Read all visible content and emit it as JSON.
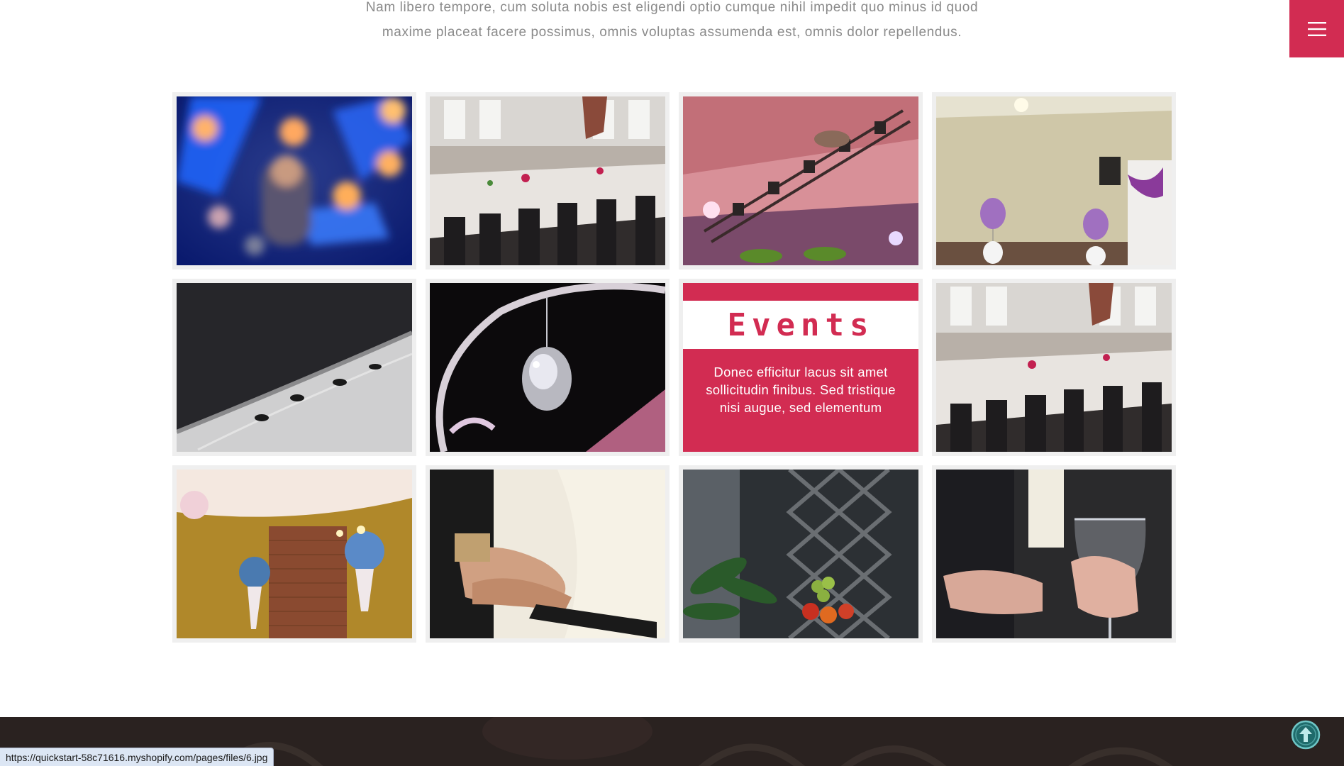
{
  "intro": {
    "line1": "Nam libero tempore, cum soluta nobis est eligendi optio cumque nihil impedit quo minus id quod",
    "line2": "maxime placeat facere possimus, omnis voluptas assumenda est, omnis dolor repellendus."
  },
  "menu": {
    "icon": "hamburger-menu-icon",
    "color": "#d22c52"
  },
  "gallery": {
    "tiles": [
      {
        "row": 1,
        "col": 1,
        "scene": "blurred blue and orange stage lights with performer"
      },
      {
        "row": 1,
        "col": 2,
        "scene": "banquet tables with white tablecloths and black chairs"
      },
      {
        "row": 1,
        "col": 3,
        "scene": "pink-lit hall ceiling with lighting truss"
      },
      {
        "row": 1,
        "col": 4,
        "scene": "hall with purple and white balloons"
      },
      {
        "row": 2,
        "col": 1,
        "scene": "close-up of white cake edge on dark background"
      },
      {
        "row": 2,
        "col": 2,
        "scene": "crystal jewelry close-up"
      },
      {
        "row": 2,
        "col": 3,
        "type": "events"
      },
      {
        "row": 2,
        "col": 4,
        "scene": "banquet tables with white tablecloths and black chairs"
      },
      {
        "row": 3,
        "col": 1,
        "scene": "hot-air-balloon decorations with brick wall"
      },
      {
        "row": 3,
        "col": 2,
        "scene": "hands cutting a cake"
      },
      {
        "row": 3,
        "col": 3,
        "scene": "fruit display near lattice screen"
      },
      {
        "row": 3,
        "col": 4,
        "scene": "hand holding wine glass"
      }
    ]
  },
  "events": {
    "title": "Events",
    "description": "Donec efficitur lacus sit amet sollicitudin finibus. Sed tristique nisi augue, sed elementum"
  },
  "status_bar": {
    "url": "https://quickstart-58c71616.myshopify.com/pages/files/6.jpg"
  },
  "back_to_top": {
    "icon": "arrow-up-circle-icon",
    "color": "#4fb3b3"
  }
}
